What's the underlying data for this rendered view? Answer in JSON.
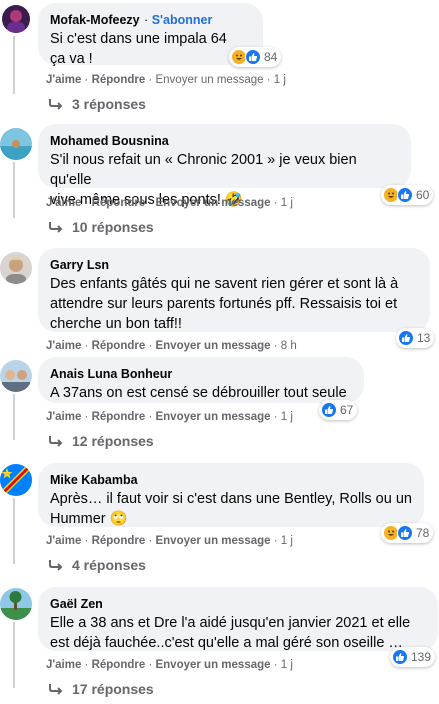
{
  "comments": [
    {
      "author": "Mofak-Mofeezy",
      "follow": "S'abonner",
      "lines": [
        "Si c'est dans une impala 64",
        "ça va !"
      ],
      "react_icons": [
        "haha-icon",
        "like-icon"
      ],
      "react_count": "84",
      "actions": {
        "like": "J'aime",
        "reply": "Répondre",
        "message": "Envoyer un message",
        "time": "1 j"
      },
      "replies": "3 réponses"
    },
    {
      "author": "Mohamed Bousnina",
      "lines": [
        "S'il nous refait un « Chronic 2001 » je veux bien qu'elle",
        "vive même sous les ponts! 🤣"
      ],
      "react_icons": [
        "haha-icon",
        "like-icon"
      ],
      "react_count": "60",
      "actions": {
        "like": "J'aime",
        "reply": "Répondre",
        "message": "Envoyer un message",
        "time": "1 j"
      },
      "replies": "10 réponses"
    },
    {
      "author": "Garry Lsn",
      "lines": [
        "Des enfants gâtés qui ne savent rien gérer et sont là à",
        "attendre sur leurs parents fortunés pff. Ressaisis toi et",
        "cherche un bon taff!!"
      ],
      "react_icons": [
        "like-icon"
      ],
      "react_count": "13",
      "actions": {
        "like": "J'aime",
        "reply": "Répondre",
        "message": "Envoyer un message",
        "time": "8 h"
      },
      "replies": ""
    },
    {
      "author": "Anais Luna Bonheur",
      "lines": [
        "A 37ans on est censé se débrouiller tout seule"
      ],
      "react_icons": [
        "like-icon"
      ],
      "react_count": "67",
      "actions": {
        "like": "J'aime",
        "reply": "Répondre",
        "message": "Envoyer un message",
        "time": "1 j"
      },
      "replies": "12 réponses"
    },
    {
      "author": "Mike Kabamba",
      "lines": [
        "Après… il faut voir si c'est dans une Bentley, Rolls ou un",
        "Hummer 🙄"
      ],
      "react_icons": [
        "haha-icon",
        "like-icon"
      ],
      "react_count": "78",
      "actions": {
        "like": "J'aime",
        "reply": "Répondre",
        "message": "Envoyer un message",
        "time": "1 j"
      },
      "replies": "4 réponses"
    },
    {
      "author": "Gaël Zen",
      "lines": [
        "Elle a 38 ans et Dre l'a aidé jusqu'en janvier 2021 et elle",
        "est déjà fauchée..c'est qu'elle a mal géré son oseille …"
      ],
      "react_icons": [
        "like-icon"
      ],
      "react_count": "139",
      "actions": {
        "like": "J'aime",
        "reply": "Répondre",
        "message": "Envoyer un message",
        "time": "1 j"
      },
      "replies": "17 réponses"
    }
  ],
  "colors": {
    "bubble": "#f0f2f5",
    "meta": "#65676b",
    "link": "#216fdb",
    "like": "#1877f2",
    "haha": "#f7b125"
  }
}
